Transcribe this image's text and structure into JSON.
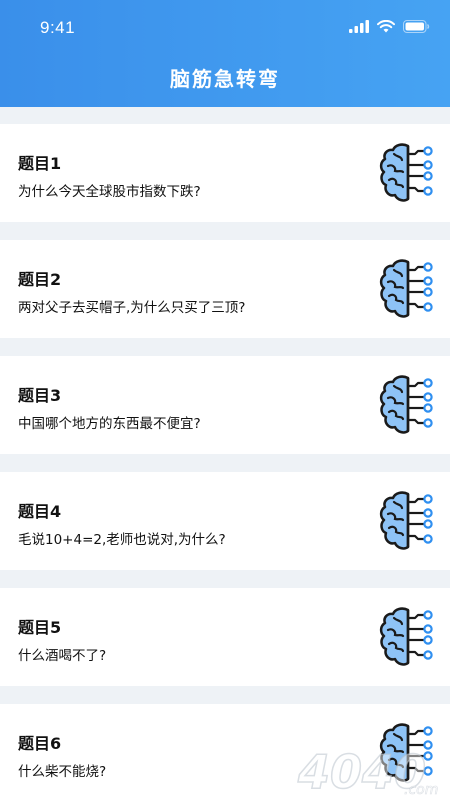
{
  "status_bar": {
    "time": "9:41",
    "icons": [
      "signal-icon",
      "wifi-icon",
      "battery-icon"
    ]
  },
  "header": {
    "title": "脑筋急转弯"
  },
  "questions": [
    {
      "label": "题目1",
      "text": "为什么今天全球股市指数下跌?"
    },
    {
      "label": "题目2",
      "text": "两对父子去买帽子,为什么只买了三顶?"
    },
    {
      "label": "题目3",
      "text": "中国哪个地方的东西最不便宜?"
    },
    {
      "label": "题目4",
      "text": "毛说10+4=2,老师也说对,为什么?"
    },
    {
      "label": "题目5",
      "text": "什么酒喝不了?"
    },
    {
      "label": "题目6",
      "text": "什么柴不能烧?"
    }
  ],
  "watermark": {
    "text": "4040",
    "suffix": ".com"
  },
  "colors": {
    "header_start": "#3a8fea",
    "header_end": "#46a3f3",
    "brain_fill": "#8ec3f6",
    "node": "#2f8ff0",
    "page_bg": "#eef2f6"
  }
}
